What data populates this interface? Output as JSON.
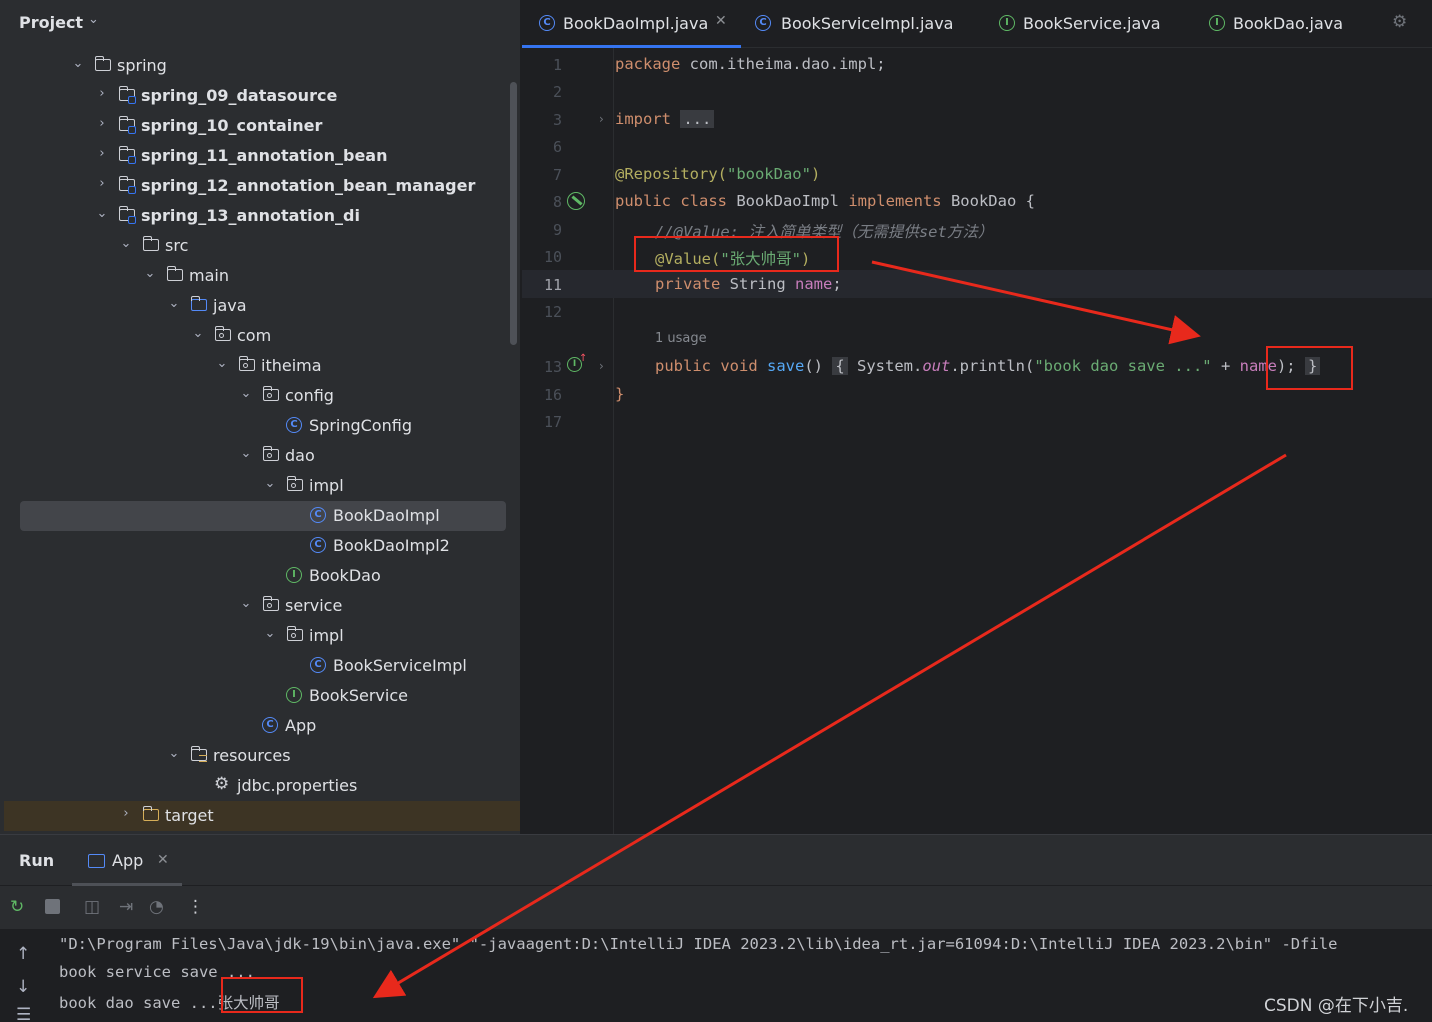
{
  "project": {
    "title": "Project",
    "tree": [
      {
        "label": "spring",
        "kind": "folder",
        "depth": 0,
        "expanded": true
      },
      {
        "label": "spring_09_datasource",
        "kind": "module",
        "depth": 1,
        "expanded": false
      },
      {
        "label": "spring_10_container",
        "kind": "module",
        "depth": 1,
        "expanded": false
      },
      {
        "label": "spring_11_annotation_bean",
        "kind": "module",
        "depth": 1,
        "expanded": false
      },
      {
        "label": "spring_12_annotation_bean_manager",
        "kind": "module",
        "depth": 1,
        "expanded": false
      },
      {
        "label": "spring_13_annotation_di",
        "kind": "module",
        "depth": 1,
        "expanded": true
      },
      {
        "label": "src",
        "kind": "folder",
        "depth": 2,
        "expanded": true
      },
      {
        "label": "main",
        "kind": "folder",
        "depth": 3,
        "expanded": true
      },
      {
        "label": "java",
        "kind": "source",
        "depth": 4,
        "expanded": true
      },
      {
        "label": "com",
        "kind": "package",
        "depth": 5,
        "expanded": true
      },
      {
        "label": "itheima",
        "kind": "package",
        "depth": 6,
        "expanded": true
      },
      {
        "label": "config",
        "kind": "package",
        "depth": 7,
        "expanded": true
      },
      {
        "label": "SpringConfig",
        "kind": "class",
        "depth": 8
      },
      {
        "label": "dao",
        "kind": "package",
        "depth": 7,
        "expanded": true
      },
      {
        "label": "impl",
        "kind": "package",
        "depth": 8,
        "expanded": true
      },
      {
        "label": "BookDaoImpl",
        "kind": "class",
        "depth": 9,
        "selected": true
      },
      {
        "label": "BookDaoImpl2",
        "kind": "class",
        "depth": 9
      },
      {
        "label": "BookDao",
        "kind": "interface",
        "depth": 8
      },
      {
        "label": "service",
        "kind": "package",
        "depth": 7,
        "expanded": true
      },
      {
        "label": "impl",
        "kind": "package",
        "depth": 8,
        "expanded": true
      },
      {
        "label": "BookServiceImpl",
        "kind": "class",
        "depth": 9
      },
      {
        "label": "BookService",
        "kind": "interface",
        "depth": 8
      },
      {
        "label": "App",
        "kind": "class",
        "depth": 7
      },
      {
        "label": "resources",
        "kind": "resources",
        "depth": 4,
        "expanded": true
      },
      {
        "label": "jdbc.properties",
        "kind": "properties",
        "depth": 5
      },
      {
        "label": "target",
        "kind": "folder-excluded",
        "depth": 2,
        "expanded": false
      }
    ]
  },
  "tabs": [
    {
      "label": "BookDaoImpl.java",
      "type": "class",
      "active": true
    },
    {
      "label": "BookServiceImpl.java",
      "type": "class",
      "active": false
    },
    {
      "label": "BookService.java",
      "type": "interface",
      "active": false
    },
    {
      "label": "BookDao.java",
      "type": "interface",
      "active": false
    }
  ],
  "editor": {
    "line_numbers": [
      "1",
      "2",
      "3",
      "6",
      "7",
      "8",
      "9",
      "10",
      "11",
      "12",
      "13",
      "16",
      "17"
    ],
    "current_line": "11",
    "usage_hint": "1 usage",
    "lines": {
      "l1": {
        "kw": "package",
        "rest": " com.itheima.dao.impl;"
      },
      "l3": {
        "kw": "import",
        "fold": "..."
      },
      "l7": {
        "ann": "@Repository(",
        "str": "\"bookDao\"",
        "ann_end": ")"
      },
      "l8": {
        "kw1": "public class",
        "name": " BookDaoImpl ",
        "kw2": "implements",
        "rest": " BookDao {"
      },
      "l9": {
        "comment": "//@Value: 注入简单类型（无需提供set方法）"
      },
      "l10": {
        "ann": "@Value(",
        "str": "\"张大帅哥\"",
        "ann_end": ")"
      },
      "l11": {
        "kw": "private",
        "type": " String ",
        "field": "name",
        "end": ";"
      },
      "l13": {
        "kw": "public void",
        "fn": "save",
        "paren": "() ",
        "fold_open": "{",
        "sys": " System.",
        "out": "out",
        "call": ".println(",
        "str": "\"book dao save ...\"",
        "plus": " + ",
        "field": "name",
        "end": "); ",
        "fold_close": "}"
      },
      "l16": {
        "brace": "}"
      }
    }
  },
  "run": {
    "title": "Run",
    "tab_label": "App",
    "console": [
      "\"D:\\Program Files\\Java\\jdk-19\\bin\\java.exe\" \"-javaagent:D:\\IntelliJ IDEA 2023.2\\lib\\idea_rt.jar=61094:D:\\IntelliJ IDEA 2023.2\\bin\" -Dfile",
      "book service save ...",
      "book dao save ..."
    ],
    "injected_value": "张大帅哥"
  },
  "watermark": "CSDN @在下小吉.",
  "colors": {
    "highlight": "#e8291c",
    "accent": "#3574f0"
  },
  "icons": {
    "tree_expand": "chevron-down-icon",
    "tree_collapse": "chevron-right-icon",
    "class": "class-c-icon",
    "interface": "interface-i-icon",
    "settings": "gear-icon"
  }
}
